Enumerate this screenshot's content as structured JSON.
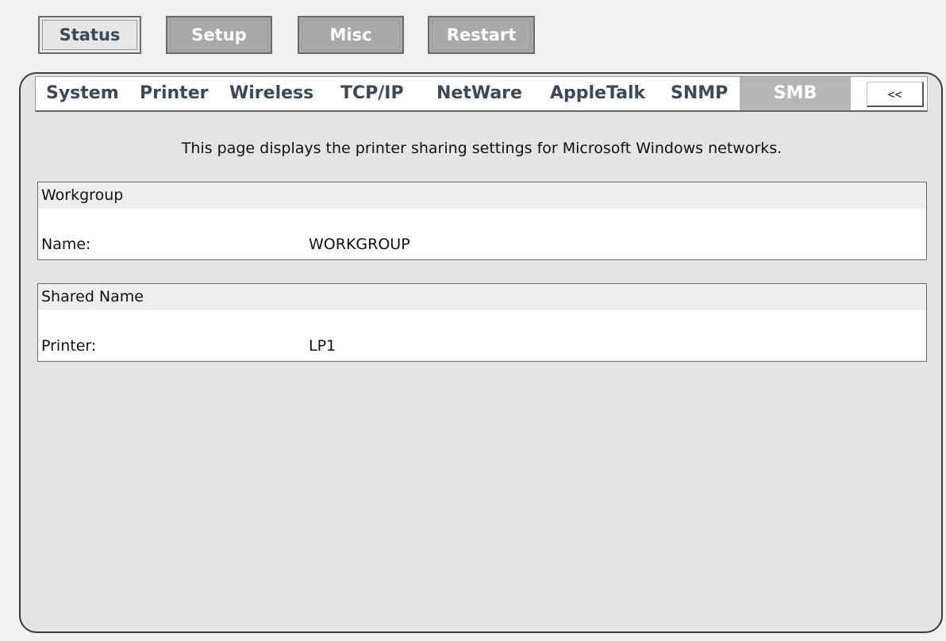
{
  "top_nav": {
    "status": "Status",
    "setup": "Setup",
    "misc": "Misc",
    "restart": "Restart"
  },
  "sub_tabs": [
    "System",
    "Printer",
    "Wireless",
    "TCP/IP",
    "NetWare",
    "AppleTalk",
    "SNMP",
    "SMB"
  ],
  "active_sub_tab": "SMB",
  "back_button": "<<",
  "description": "This page displays the printer sharing settings for Microsoft Windows networks.",
  "workgroup": {
    "header": "Workgroup",
    "name_label": "Name:",
    "name_value": "WORKGROUP"
  },
  "shared_name": {
    "header": "Shared Name",
    "printer_label": "Printer:",
    "printer_value": "LP1"
  },
  "colors": {
    "page_bg": "#f0f0f0",
    "panel_bg": "#e4e4e4",
    "active_button": "#a9a9a9",
    "tab_text": "#3a4a5a"
  }
}
